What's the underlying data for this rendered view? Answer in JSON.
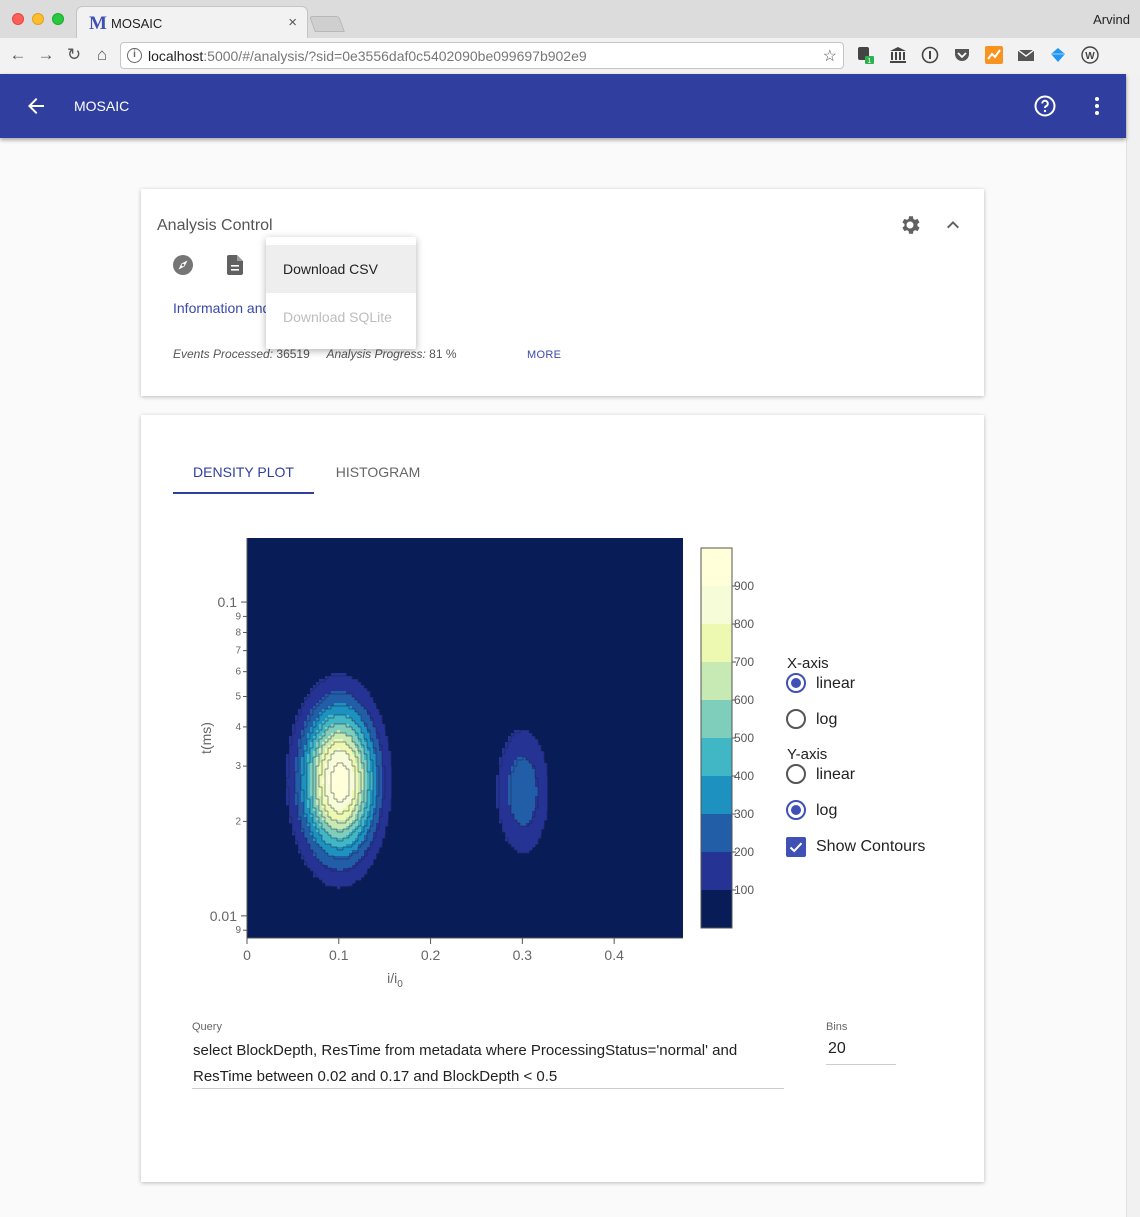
{
  "browser": {
    "tab_logo": "M",
    "tab_title": "MOSAIC",
    "tab_close": "×",
    "profile": "Arvind",
    "url_host": "localhost",
    "url_rest": ":5000/#/analysis/?sid=0e3556daf0c5402090be099697b902e9",
    "nav": {
      "back": "←",
      "forward": "→",
      "reload": "↻",
      "home": "⌂"
    },
    "star": "☆",
    "extensions": [
      "evernote-icon",
      "library-icon",
      "info-icon",
      "pocket-icon",
      "orange-chart-icon",
      "mail-icon",
      "diamond-icon",
      "w-icon"
    ]
  },
  "appbar": {
    "title": "MOSAIC",
    "color": "#303f9f"
  },
  "analysis_control": {
    "title": "Analysis Control",
    "info_link": "Information and",
    "events_label": "Events Processed:",
    "events_value": "36519",
    "progress_label": "Analysis Progress:",
    "progress_value": "81 %",
    "more": "MORE"
  },
  "download_menu": {
    "items": [
      {
        "label": "Download CSV",
        "state": "hover"
      },
      {
        "label": "Download SQLite",
        "state": "disabled"
      }
    ]
  },
  "plot_tabs": [
    {
      "label": "DENSITY PLOT",
      "active": true
    },
    {
      "label": "HISTOGRAM",
      "active": false
    }
  ],
  "axis_options": {
    "x_title": "X-axis",
    "x_linear": "linear",
    "x_log": "log",
    "x_selected": "linear",
    "y_title": "Y-axis",
    "y_linear": "linear",
    "y_log": "log",
    "y_selected": "log",
    "show_contours": "Show Contours",
    "show_contours_checked": true
  },
  "query": {
    "label": "Query",
    "value": "select BlockDepth, ResTime from metadata where ProcessingStatus='normal' and ResTime between 0.02 and 0.17 and BlockDepth < 0.5"
  },
  "bins": {
    "label": "Bins",
    "value": "20"
  },
  "chart_data": {
    "type": "heatmap",
    "xlabel": "i/i",
    "xlabel_sub": "0",
    "ylabel": "t(ms)",
    "x_scale": "linear",
    "y_scale": "log",
    "xlim": [
      0,
      0.475
    ],
    "ylim": [
      0.0085,
      0.16
    ],
    "x_ticks": [
      0,
      0.1,
      0.2,
      0.3,
      0.4
    ],
    "x_tick_labels": [
      "0",
      "0.1",
      "0.2",
      "0.3",
      "0.4"
    ],
    "y_major_ticks": [
      {
        "value": 0.1,
        "label": "0.1"
      },
      {
        "value": 0.01,
        "label": "0.01"
      }
    ],
    "y_minor_ticks": [
      {
        "value": 0.09,
        "label": "9"
      },
      {
        "value": 0.08,
        "label": "8"
      },
      {
        "value": 0.07,
        "label": "7"
      },
      {
        "value": 0.06,
        "label": "6"
      },
      {
        "value": 0.05,
        "label": "5"
      },
      {
        "value": 0.04,
        "label": "4"
      },
      {
        "value": 0.03,
        "label": "3"
      },
      {
        "value": 0.02,
        "label": "2"
      },
      {
        "value": 0.009,
        "label": "9"
      }
    ],
    "colorbar_ticks": [
      "100",
      "200",
      "300",
      "400",
      "500",
      "600",
      "700",
      "800",
      "900"
    ],
    "colorbar_levels": [
      0,
      100,
      200,
      300,
      400,
      500,
      600,
      700,
      800,
      900,
      1000
    ],
    "colorscale": [
      "#081d58",
      "#253494",
      "#225ea8",
      "#1d91c0",
      "#41b6c4",
      "#7fcdbb",
      "#c7e9b4",
      "#edf8b1",
      "#f7fcd8",
      "#ffffd9"
    ],
    "peaks": [
      {
        "x": 0.1,
        "y": 0.027,
        "max": 970,
        "sx": 0.027,
        "sy_log": 0.16
      },
      {
        "x": 0.3,
        "y": 0.025,
        "max": 270,
        "sx": 0.02,
        "sy_log": 0.14
      }
    ],
    "contours": true
  }
}
